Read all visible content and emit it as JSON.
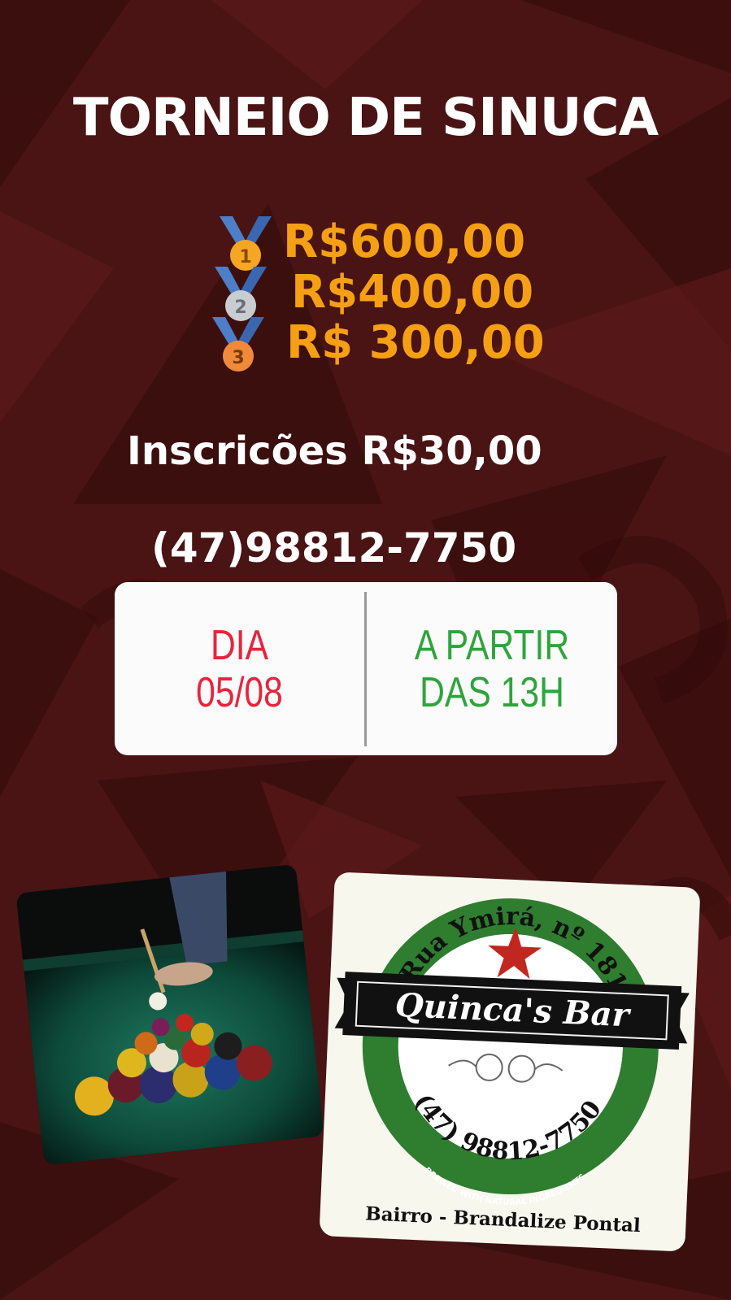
{
  "title": "TORNEIO DE SINUCA",
  "prizes": [
    {
      "place": "1",
      "value": "R$600,00",
      "medal_color": "#f5a623"
    },
    {
      "place": "2",
      "value": "R$400,00",
      "medal_color": "#c8cdd2"
    },
    {
      "place": "3",
      "value": "R$ 300,00",
      "medal_color": "#f08a3a"
    }
  ],
  "registration": "Inscricões R$30,00",
  "phone": "(47)98812-7750",
  "schedule": {
    "day_label": "DIA",
    "date": "05/08",
    "time_line1": "A PARTIR",
    "time_line2": "DAS 13H"
  },
  "logo": {
    "address_arc": "Rua Ymirá, nº 181",
    "bar_name": "Quinca's Bar",
    "phone_arc": "(47) 98812-7750",
    "tagline_arc": "BREWED WITH NATURAL INGREDIENTS",
    "neighborhood": "Bairro - Brandalize Pontal"
  },
  "colors": {
    "background": "#4a1212",
    "prize": "#f5a014",
    "date": "#e8243c",
    "time": "#2fa43c",
    "logo_green": "#2f7d2f"
  }
}
